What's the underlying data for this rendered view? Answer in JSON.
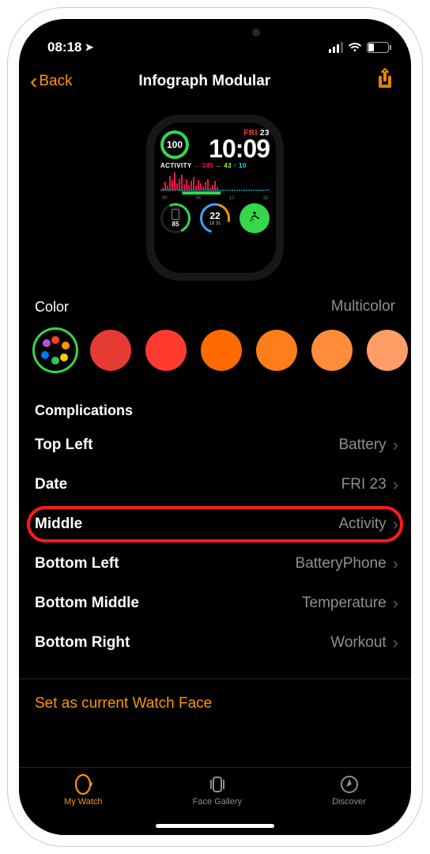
{
  "status": {
    "time": "08:18"
  },
  "nav": {
    "back": "Back",
    "title": "Infograph Modular"
  },
  "preview": {
    "ring_pct": "100",
    "day_abbr": "FRI",
    "day_num": "23",
    "time": "10:09",
    "activity_label": "ACTIVITY",
    "activity_move": "345",
    "activity_ex": "43",
    "activity_stand": "10",
    "ticks": [
      "00",
      "06",
      "12",
      "18"
    ],
    "batt_pct": "85",
    "temp": "22",
    "temp_range": "18  31"
  },
  "color": {
    "header": "Color",
    "value": "Multicolor",
    "swatches": [
      "#e63b32",
      "#ff3b30",
      "#ff6a00",
      "#ff7d1a",
      "#ff8c3a",
      "#ff9d66"
    ]
  },
  "complications": {
    "header": "Complications",
    "rows": [
      {
        "label": "Top Left",
        "value": "Battery"
      },
      {
        "label": "Date",
        "value": "FRI 23"
      },
      {
        "label": "Middle",
        "value": "Activity",
        "highlight": true
      },
      {
        "label": "Bottom Left",
        "value": "BatteryPhone"
      },
      {
        "label": "Bottom Middle",
        "value": "Temperature"
      },
      {
        "label": "Bottom Right",
        "value": "Workout"
      }
    ]
  },
  "set_face": "Set as current Watch Face",
  "tabs": {
    "watch": "My Watch",
    "gallery": "Face Gallery",
    "discover": "Discover"
  }
}
